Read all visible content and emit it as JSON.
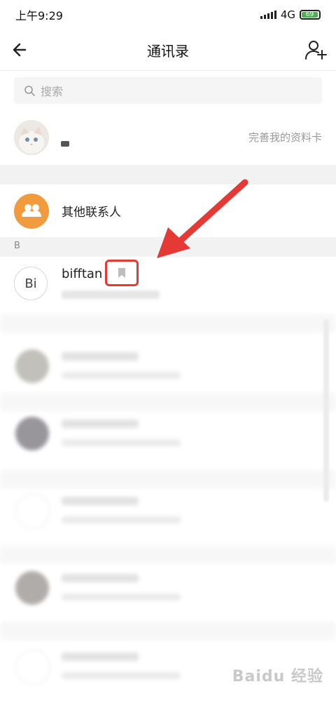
{
  "status_bar": {
    "time": "上午9:29",
    "network": "4G",
    "battery": "69"
  },
  "header": {
    "title": "通讯录",
    "back_icon": "arrow-left-icon",
    "add_icon": "add-user-icon"
  },
  "search": {
    "placeholder": "搜索"
  },
  "my_card": {
    "link_text": "完善我的资料卡"
  },
  "other_contacts": {
    "label": "其他联系人"
  },
  "section_b": {
    "letter": "B"
  },
  "contact_b": {
    "avatar_text": "Bi",
    "name": "bifftan"
  },
  "watermark": {
    "text": "Baidu 经验"
  },
  "colors": {
    "accent_orange": "#f19a3e",
    "highlight_red": "#e53935",
    "battery_green": "#4caf50"
  }
}
